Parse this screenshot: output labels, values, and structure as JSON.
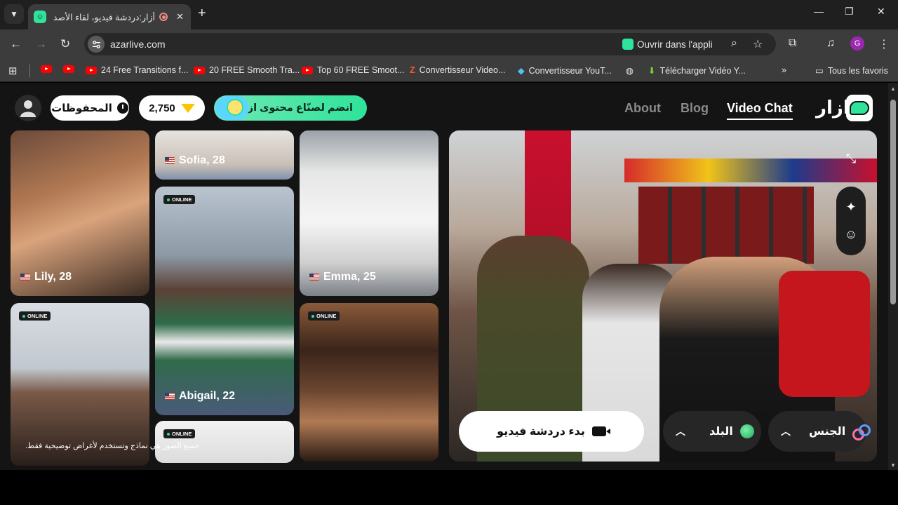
{
  "browser": {
    "tab_title": "أزار:دردشة فيديو، لقاء الأصدقاء",
    "url": "azarlive.com",
    "open_in_app": "Ouvrir dans l'appli",
    "profile_initial": "G",
    "bookmarks": [
      {
        "label": "",
        "icon": "youtube-icon"
      },
      {
        "label": "",
        "icon": "youtube-icon"
      },
      {
        "label": "24 Free Transitions f...",
        "icon": "youtube-icon"
      },
      {
        "label": "20 FREE Smooth Tra...",
        "icon": "youtube-icon"
      },
      {
        "label": "Top 60 FREE Smoot...",
        "icon": "youtube-icon"
      },
      {
        "label": "Convertisseur Video...",
        "icon": "z-icon"
      },
      {
        "label": "Convertisseur YouT...",
        "icon": "converter-icon"
      },
      {
        "label": "",
        "icon": "globe-icon"
      },
      {
        "label": "Télécharger Vidéo Y...",
        "icon": "download-icon"
      }
    ],
    "all_bookmarks": "Tous les favoris"
  },
  "header": {
    "saved_label": "المحفوظات",
    "gems_count": "2,750",
    "creator_label": "انضم لصنّاع محتوى ازار",
    "nav": {
      "about": "About",
      "blog": "Blog",
      "video_chat": "Video Chat"
    },
    "logo_text": "ازار"
  },
  "profiles": [
    {
      "name": "Lily, 28",
      "online": false
    },
    {
      "name": "Sofia, 28",
      "online": false
    },
    {
      "name": "Emma, 25",
      "online": false
    },
    {
      "name": "Abigail, 22",
      "online": true
    },
    {
      "name": "",
      "online": true
    },
    {
      "name": "",
      "online": true
    },
    {
      "name": "",
      "online": true
    }
  ],
  "online_badge": "ONLINE",
  "disclaimer": "جميع الصور هي نماذج وتستخدم لأغراض توضيحية فقط.",
  "controls": {
    "start_video_chat": "بدء دردشة فيديو",
    "country": "البلد",
    "gender": "الجنس"
  },
  "colors": {
    "brand_green": "#2fe39a",
    "page_bg": "#141414"
  }
}
